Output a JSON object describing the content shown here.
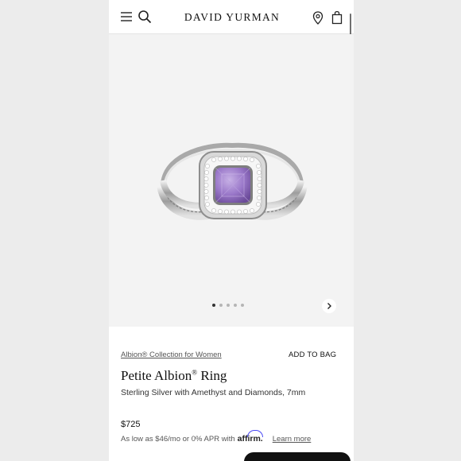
{
  "header": {
    "brand": "DAVID YURMAN",
    "menu_icon": "menu-icon",
    "search_icon": "search-icon",
    "location_icon": "location-pin-icon",
    "bag_icon": "shopping-bag-icon"
  },
  "gallery": {
    "image": "ring-product-image",
    "slide_count": 5,
    "active_slide": 1,
    "next_icon": "chevron-right-icon"
  },
  "product": {
    "collection_link": "Albion® Collection for Women",
    "add_to_bag": "ADD TO BAG",
    "title": "Petite Albion",
    "title_mark": "®",
    "title_suffix": " Ring",
    "subtitle": "Sterling Silver with Amethyst and Diamonds, 7mm",
    "price": "$725",
    "financing_text": "As low as $46/mo or 0% APR with",
    "financing_brand": "affirm.",
    "learn_more": "Learn more"
  },
  "colors": {
    "page_background": "#ececec",
    "text": "#111111",
    "amethyst": "#9a78c9",
    "affirm_blue": "#4a4af4"
  }
}
